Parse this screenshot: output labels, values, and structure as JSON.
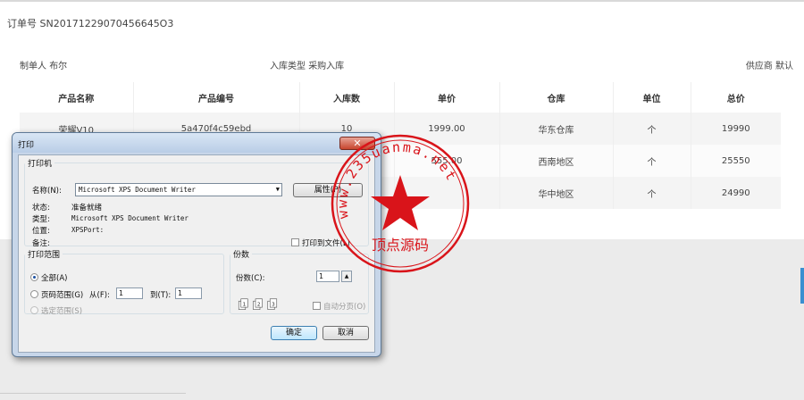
{
  "order": {
    "label": "订单号",
    "number": "SN20171229070456645O3"
  },
  "meta": {
    "maker_label": "制单人",
    "maker": "布尔",
    "type_label": "入库类型",
    "type": "采购入库",
    "supplier_label": "供应商",
    "supplier": "默认"
  },
  "table": {
    "headers": [
      "产品名称",
      "产品编号",
      "入库数",
      "单价",
      "仓库",
      "单位",
      "总价"
    ],
    "rows": [
      [
        "荣耀V10",
        "5a470f4c59ebd",
        "10",
        "1999.00",
        "华东仓库",
        "个",
        "19990"
      ],
      [
        "",
        "",
        "",
        "555.00",
        "西南地区",
        "个",
        "25550"
      ],
      [
        "",
        "",
        "",
        "",
        "华中地区",
        "个",
        "24990"
      ]
    ]
  },
  "dialog": {
    "title": "打印",
    "close": "✕",
    "printer_group": "打印机",
    "name_label": "名称(N):",
    "printer_name": "Microsoft XPS Document Writer",
    "properties_button": "属性(P)",
    "status_label": "状态:",
    "status": "准备就绪",
    "type_label": "类型:",
    "type": "Microsoft XPS Document Writer",
    "where_label": "位置:",
    "where": "XPSPort:",
    "comment_label": "备注:",
    "print_to_file": "打印到文件(L)",
    "range_group": "打印范围",
    "all_option": "全部(A)",
    "pages_option": "页码范围(G)",
    "from_label": "从(F):",
    "from_value": "1",
    "to_label": "到(T):",
    "to_value": "1",
    "selection_option": "选定范围(S)",
    "copies_group": "份数",
    "copies_label": "份数(C):",
    "copies_value": "1",
    "collate_label": "自动分页(O)",
    "ok_button": "确定",
    "cancel_button": "取消"
  },
  "stamp": {
    "ring_text": "www.235uanma.net",
    "bottom_text": "顶点源码",
    "color": "#d9141a"
  }
}
